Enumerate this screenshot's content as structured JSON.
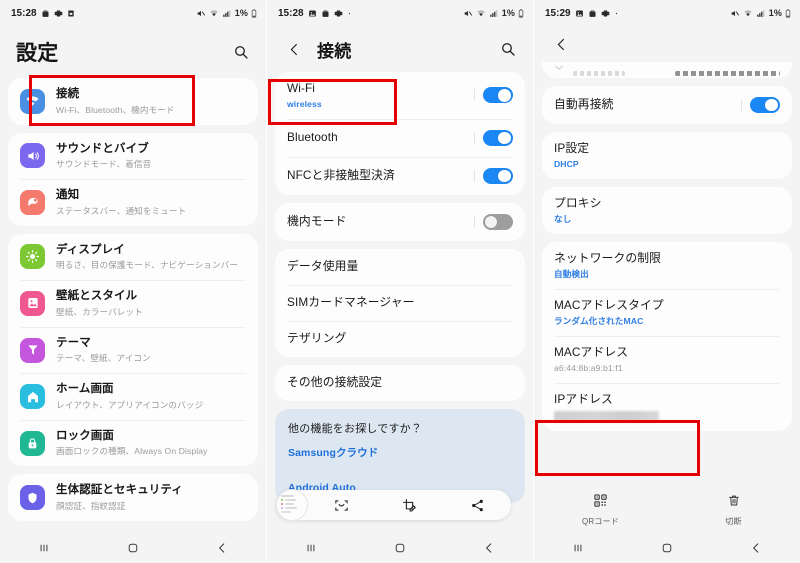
{
  "screens": [
    {
      "id": "settings-home",
      "statusbar": {
        "clock": "15:28",
        "battery": "1%",
        "left_icons": [
          "bag-icon",
          "gear-icon",
          "sim-icon"
        ],
        "right_icons": [
          "mute-icon",
          "wifi-weak-icon",
          "signal-icon",
          "battery-icon"
        ]
      },
      "header": {
        "title": "設定",
        "search_icon": "search-icon"
      },
      "groups": [
        {
          "items": [
            {
              "icon": "wifi-icon",
              "color": "#4a90e2",
              "title": "接続",
              "subtitle": "Wi-Fi、Bluetooth、機内モード",
              "highlighted": true
            }
          ]
        },
        {
          "items": [
            {
              "icon": "sound-icon",
              "color": "#7b68ee",
              "title": "サウンドとバイブ",
              "subtitle": "サウンドモード、着信音"
            },
            {
              "icon": "notification-icon",
              "color": "#f47a6e",
              "title": "通知",
              "subtitle": "ステータスバー、通知をミュート"
            }
          ]
        },
        {
          "items": [
            {
              "icon": "display-icon",
              "color": "#7dc832",
              "title": "ディスプレイ",
              "subtitle": "明るさ、目の保護モード、ナビゲーションバー"
            },
            {
              "icon": "wallpaper-icon",
              "color": "#f0568f",
              "title": "壁紙とスタイル",
              "subtitle": "壁紙、カラーパレット"
            },
            {
              "icon": "theme-icon",
              "color": "#c455dd",
              "title": "テーマ",
              "subtitle": "テーマ、壁紙、アイコン"
            },
            {
              "icon": "home-icon",
              "color": "#29bde0",
              "title": "ホーム画面",
              "subtitle": "レイアウト、アプリアイコンのバッジ"
            },
            {
              "icon": "lock-icon",
              "color": "#20b894",
              "title": "ロック画面",
              "subtitle": "画面ロックの種類、Always On Display"
            }
          ]
        },
        {
          "items": [
            {
              "icon": "shield-icon",
              "color": "#6a61e8",
              "title": "生体認証とセキュリティ",
              "subtitle": "顔認証、指紋認証"
            }
          ]
        }
      ],
      "navbar": [
        "recents-icon",
        "home-icon",
        "back-icon"
      ]
    },
    {
      "id": "connections",
      "statusbar": {
        "clock": "15:28",
        "battery": "1%",
        "left_icons": [
          "gallery-icon",
          "bag-icon",
          "gear-icon",
          "dot-icon"
        ],
        "right_icons": [
          "mute-icon",
          "wifi-weak-icon",
          "signal-icon",
          "battery-icon"
        ]
      },
      "header": {
        "back_icon": "back-icon",
        "title": "接続",
        "search_icon": "search-icon"
      },
      "groups": [
        {
          "items": [
            {
              "title": "Wi-Fi",
              "subtitle": "wireless",
              "subtitle_blue": true,
              "toggle": "on",
              "highlighted": true
            },
            {
              "title": "Bluetooth",
              "toggle": "on"
            },
            {
              "title": "NFCと非接触型決済",
              "toggle": "on"
            }
          ]
        },
        {
          "items": [
            {
              "title": "機内モード",
              "toggle": "off"
            }
          ]
        },
        {
          "items": [
            {
              "title": "データ使用量"
            },
            {
              "title": "SIMカードマネージャー"
            },
            {
              "title": "テザリング"
            }
          ]
        },
        {
          "items": [
            {
              "title": "その他の接続設定"
            }
          ]
        }
      ],
      "promo": {
        "title": "他の機能をお探しですか？",
        "link1": "Samsungクラウド",
        "link2": "Android Auto"
      },
      "floatbar": {
        "thumbnail": "screenshot-thumbnail",
        "actions": [
          "smart-select-icon",
          "crop-edit-icon",
          "share-icon"
        ]
      },
      "navbar": [
        "recents-icon",
        "home-icon",
        "back-icon"
      ]
    },
    {
      "id": "wifi-network-detail",
      "statusbar": {
        "clock": "15:29",
        "battery": "1%",
        "left_icons": [
          "gallery-icon",
          "bag-icon",
          "gear-icon",
          "dot-icon"
        ],
        "right_icons": [
          "mute-icon",
          "wifi-weak-icon",
          "signal-icon",
          "battery-icon"
        ]
      },
      "header": {
        "back_icon": "back-icon",
        "title": ""
      },
      "cutoff_row": {
        "icon": "chevron-down-icon"
      },
      "groups": [
        {
          "items": [
            {
              "title": "自動再接続",
              "toggle": "on"
            }
          ]
        },
        {
          "items": [
            {
              "title": "IP設定",
              "subtitle": "DHCP",
              "subtitle_blue": true
            }
          ]
        },
        {
          "items": [
            {
              "title": "プロキシ",
              "subtitle": "なし",
              "subtitle_blue": true
            }
          ]
        },
        {
          "items": [
            {
              "title": "ネットワークの制限",
              "subtitle": "自動検出",
              "subtitle_blue": true
            },
            {
              "title": "MACアドレスタイプ",
              "subtitle": "ランダム化されたMAC",
              "subtitle_blue": true
            },
            {
              "title": "MACアドレス",
              "subtitle": "a6:44:8b:a9:b1:f1"
            },
            {
              "title": "IPアドレス",
              "subtitle_redacted": true,
              "highlighted": true
            }
          ]
        }
      ],
      "actionbar": [
        {
          "icon": "qr-code-icon",
          "label": "QRコード"
        },
        {
          "icon": "trash-icon",
          "label": "切断"
        }
      ],
      "navbar": [
        "recents-icon",
        "home-icon",
        "back-icon"
      ]
    }
  ],
  "highlight_color": "#e60000",
  "accent_color": "#1b87f5",
  "link_color": "#2f7de1"
}
